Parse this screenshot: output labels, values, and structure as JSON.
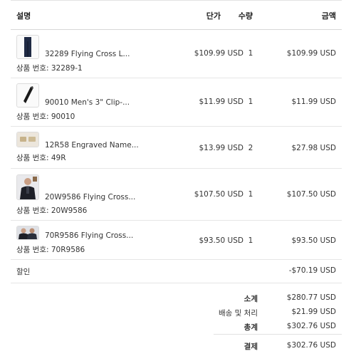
{
  "table": {
    "headers": {
      "description": "설명",
      "unit_price": "단가",
      "quantity": "수량",
      "amount": "금액"
    },
    "rows": [
      {
        "name": "32289 Flying Cross L...",
        "item_number": "상품 번호: 32289-1",
        "unit_price": "$109.99 USD",
        "quantity": "1",
        "amount": "$109.99 USD",
        "thumb_icon": "pants-icon"
      },
      {
        "name": "90010 Men's 3\" Clip-...",
        "item_number": "상품 번호: 90010",
        "unit_price": "$11.99 USD",
        "quantity": "1",
        "amount": "$11.99 USD",
        "thumb_icon": "tie-icon"
      },
      {
        "name": "12R58 Engraved Name...",
        "item_number": "상품 번호: 49R",
        "unit_price": "$13.99 USD",
        "quantity": "2",
        "amount": "$27.98 USD",
        "thumb_icon": "nameplate-icon"
      },
      {
        "name": "20W9586 Flying Cross...",
        "item_number": "상품 번호: 20W9586",
        "unit_price": "$107.50 USD",
        "quantity": "1",
        "amount": "$107.50 USD",
        "thumb_icon": "jacket-photo-icon"
      },
      {
        "name": "70R9586 Flying Cross...",
        "item_number": "상품 번호: 70R9586",
        "unit_price": "$93.50 USD",
        "quantity": "1",
        "amount": "$93.50 USD",
        "thumb_icon": "jacket-photo-icon"
      }
    ]
  },
  "discount": {
    "label": "할인",
    "amount": "-$70.19 USD"
  },
  "totals": {
    "subtotal_label": "소계",
    "subtotal": "$280.77 USD",
    "shipping_label": "배송 및 처리",
    "shipping": "$21.99 USD",
    "total_label": "총계",
    "total": "$302.76 USD",
    "payment_label": "결제",
    "payment": "$302.76 USD"
  }
}
